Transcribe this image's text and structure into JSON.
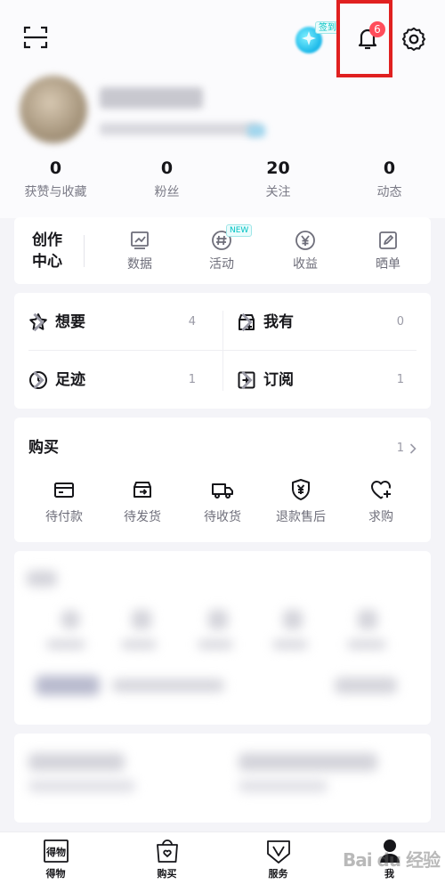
{
  "header": {
    "checkin_label": "签到",
    "notification_count": "6"
  },
  "stats": [
    {
      "value": "0",
      "label": "获赞与收藏"
    },
    {
      "value": "0",
      "label": "粉丝"
    },
    {
      "value": "20",
      "label": "关注"
    },
    {
      "value": "0",
      "label": "动态"
    }
  ],
  "creator": {
    "title": "创作中心",
    "new_badge": "NEW",
    "items": [
      {
        "label": "数据",
        "icon": "chart-icon"
      },
      {
        "label": "活动",
        "icon": "hashtag-icon"
      },
      {
        "label": "收益",
        "icon": "yen-icon"
      },
      {
        "label": "晒单",
        "icon": "edit-icon"
      }
    ]
  },
  "collections": [
    {
      "label": "想要",
      "count": "4",
      "icon": "star-icon"
    },
    {
      "label": "我有",
      "count": "0",
      "icon": "box-icon"
    },
    {
      "label": "足迹",
      "count": "1",
      "icon": "clock-icon"
    },
    {
      "label": "订阅",
      "count": "1",
      "icon": "plus-square-icon"
    }
  ],
  "purchases": {
    "title": "购买",
    "count": "1",
    "items": [
      {
        "label": "待付款",
        "icon": "card-icon"
      },
      {
        "label": "待发货",
        "icon": "outbox-icon"
      },
      {
        "label": "待收货",
        "icon": "truck-icon"
      },
      {
        "label": "退款售后",
        "icon": "shield-yen-icon"
      },
      {
        "label": "求购",
        "icon": "heart-plus-icon"
      }
    ]
  },
  "tabbar": [
    {
      "label": "得物",
      "icon": "home-logo-icon"
    },
    {
      "label": "购买",
      "icon": "bag-heart-icon"
    },
    {
      "label": "服务",
      "icon": "shield-v-icon"
    },
    {
      "label": "我",
      "icon": "profile-icon"
    }
  ],
  "watermark": "Bai du 经验"
}
